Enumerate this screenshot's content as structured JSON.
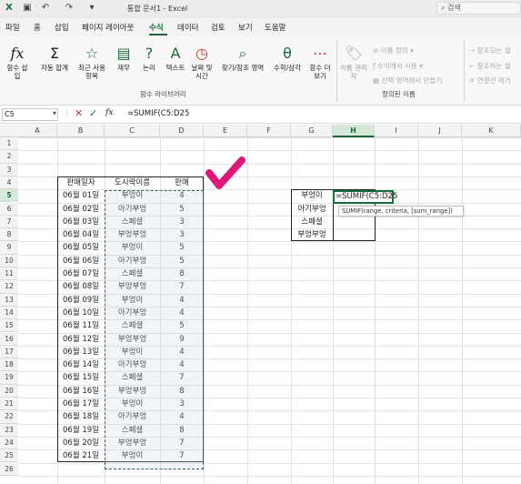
{
  "titlebar": {
    "title": "통합 문서1 - Excel",
    "search_placeholder": "검색"
  },
  "menu": {
    "tabs": [
      "파일",
      "홈",
      "삽입",
      "페이지 레이아웃",
      "수식",
      "데이터",
      "검토",
      "보기",
      "도움말"
    ],
    "active_tab": "수식"
  },
  "ribbon": {
    "function_library": {
      "label": "함수 라이브러리",
      "buttons": [
        "함수 삽입",
        "자동 합계",
        "최근 사용 항목",
        "재무",
        "논리",
        "텍스트",
        "날짜 및 시간",
        "찾기/참조 영역",
        "수학/삼각",
        "함수 더 보기"
      ]
    },
    "defined_names": {
      "label": "정의된 이름",
      "name_manager": "이름 관리자",
      "items": [
        "이름 정의",
        "수식에서 사용",
        "선택 영역에서 만들기"
      ]
    },
    "auditing": {
      "items": [
        "참조되는 셀",
        "참조하는 셀",
        "연결선 제거"
      ]
    }
  },
  "formula_bar": {
    "name_box": "C5",
    "formula": "=SUMIF(C5:D25"
  },
  "columns": [
    "A",
    "B",
    "C",
    "D",
    "E",
    "F",
    "G",
    "H",
    "I",
    "J",
    "K"
  ],
  "rows": [
    "1",
    "2",
    "3",
    "4",
    "5",
    "6",
    "7",
    "8",
    "9",
    "10",
    "11",
    "12",
    "13",
    "14",
    "15",
    "16",
    "17",
    "18",
    "19",
    "20",
    "21",
    "22",
    "23",
    "24",
    "25",
    "26"
  ],
  "table": {
    "headers": [
      "판매일자",
      "도시락이름",
      "판매"
    ],
    "rows": [
      [
        "06월 01일",
        "부엉이",
        "4"
      ],
      [
        "06월 02일",
        "아기부엉",
        "5"
      ],
      [
        "06월 03일",
        "스페셜",
        "3"
      ],
      [
        "06월 04일",
        "부엉부엉",
        "3"
      ],
      [
        "06월 05일",
        "부엉이",
        "5"
      ],
      [
        "06월 06일",
        "아기부엉",
        "5"
      ],
      [
        "06월 07일",
        "스페셜",
        "8"
      ],
      [
        "06월 08일",
        "부엉부엉",
        "7"
      ],
      [
        "06월 09일",
        "부엉이",
        "4"
      ],
      [
        "06월 10일",
        "아기부엉",
        "4"
      ],
      [
        "06월 11일",
        "스페셜",
        "5"
      ],
      [
        "06월 12일",
        "부엉부엉",
        "9"
      ],
      [
        "06월 13일",
        "부엉이",
        "4"
      ],
      [
        "06월 14일",
        "아기부엉",
        "4"
      ],
      [
        "06월 15일",
        "스페셜",
        "7"
      ],
      [
        "06월 16일",
        "부엉부엉",
        "8"
      ],
      [
        "06월 17일",
        "부엉이",
        "3"
      ],
      [
        "06월 18일",
        "아기부엉",
        "4"
      ],
      [
        "06월 19일",
        "스페셜",
        "8"
      ],
      [
        "06월 20일",
        "부엉부엉",
        "7"
      ],
      [
        "06월 21일",
        "부엉이",
        "7"
      ]
    ]
  },
  "summary": {
    "items": [
      "부엉이",
      "아기부엉",
      "스페셜",
      "부엉부엉"
    ],
    "editing_value": "=SUMIF(C5:D25",
    "tooltip": "SUMIF(range, criteria, [sum_range])"
  },
  "colors": {
    "accent": "#1b6b3a",
    "checkmark": "#e0177a"
  }
}
